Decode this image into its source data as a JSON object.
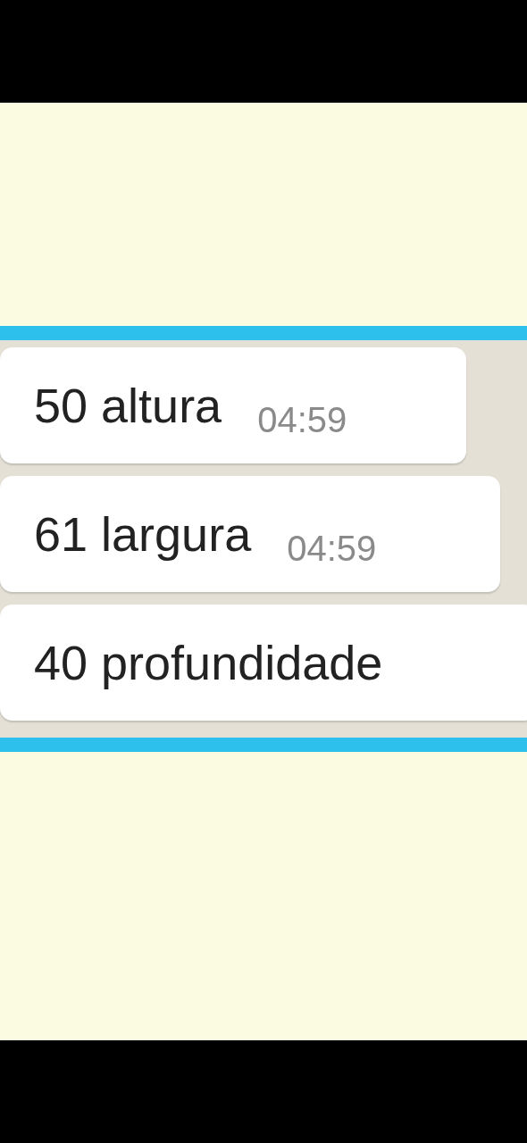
{
  "messages": [
    {
      "text": "50 altura",
      "time": "04:59"
    },
    {
      "text": "61 largura",
      "time": "04:59"
    },
    {
      "text": "40 profundidade"
    }
  ]
}
